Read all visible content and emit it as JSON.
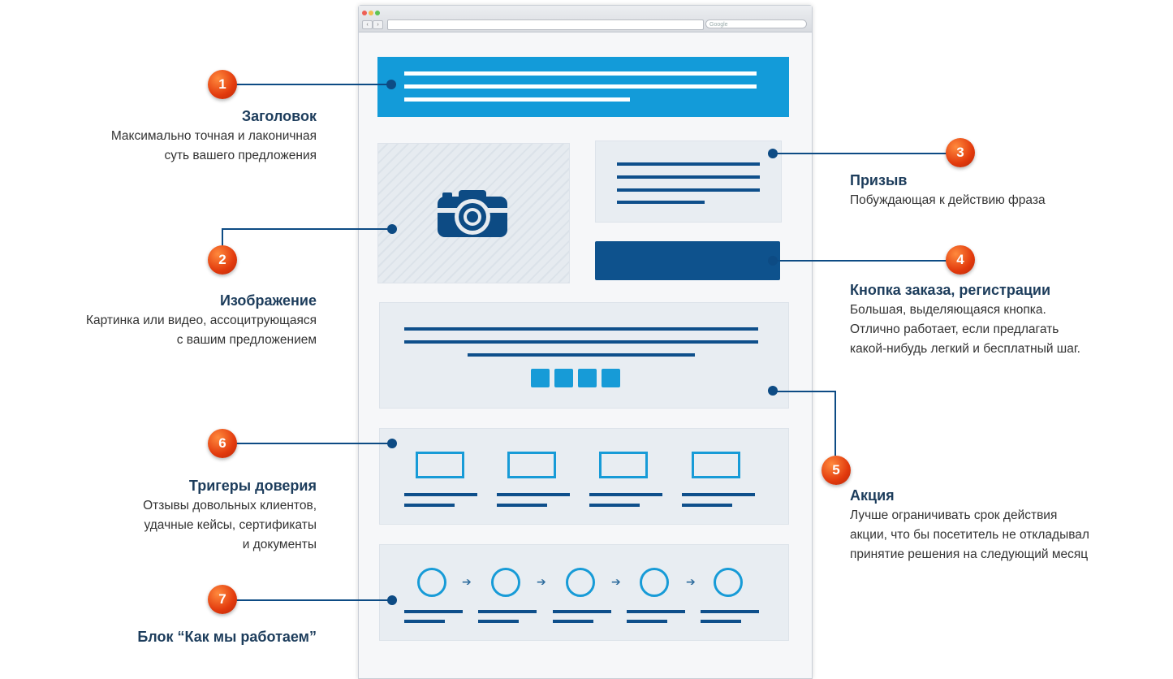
{
  "browser": {
    "search_placeholder": "Google",
    "nav_back": "‹",
    "nav_forward": "›"
  },
  "callouts": [
    {
      "number": "1",
      "title": "Заголовок",
      "lines": [
        "Максимально точная и лаконичная",
        "суть вашего предложения"
      ]
    },
    {
      "number": "2",
      "title": "Изображение",
      "lines": [
        "Картинка или видео, ассоцитрующаяся",
        "с вашим предложением"
      ]
    },
    {
      "number": "3",
      "title": "Призыв",
      "lines": [
        "Побуждающая к действию фраза"
      ]
    },
    {
      "number": "4",
      "title": "Кнопка заказа, регистрации",
      "lines": [
        "Большая, выделяющаяся кнопка.",
        "Отлично работает, если предлагать",
        "какой-нибудь легкий и бесплатный шаг."
      ]
    },
    {
      "number": "5",
      "title": "Акция",
      "lines": [
        "Лучше ограничивать срок действия",
        "акции, что бы посетитель не откладывал",
        "принятие решения на следующий месяц"
      ]
    },
    {
      "number": "6",
      "title": "Тригеры доверия",
      "lines": [
        "Отзывы довольных клиентов,",
        "удачные кейсы, сертификаты",
        "и документы"
      ]
    },
    {
      "number": "7",
      "title": "Блок “Как мы работаем”",
      "lines": []
    }
  ],
  "colors": {
    "accent_blue": "#139bd9",
    "dark_blue": "#0e528d",
    "badge_orange": "#e23a0d",
    "panel_bg": "#e8edf2"
  }
}
